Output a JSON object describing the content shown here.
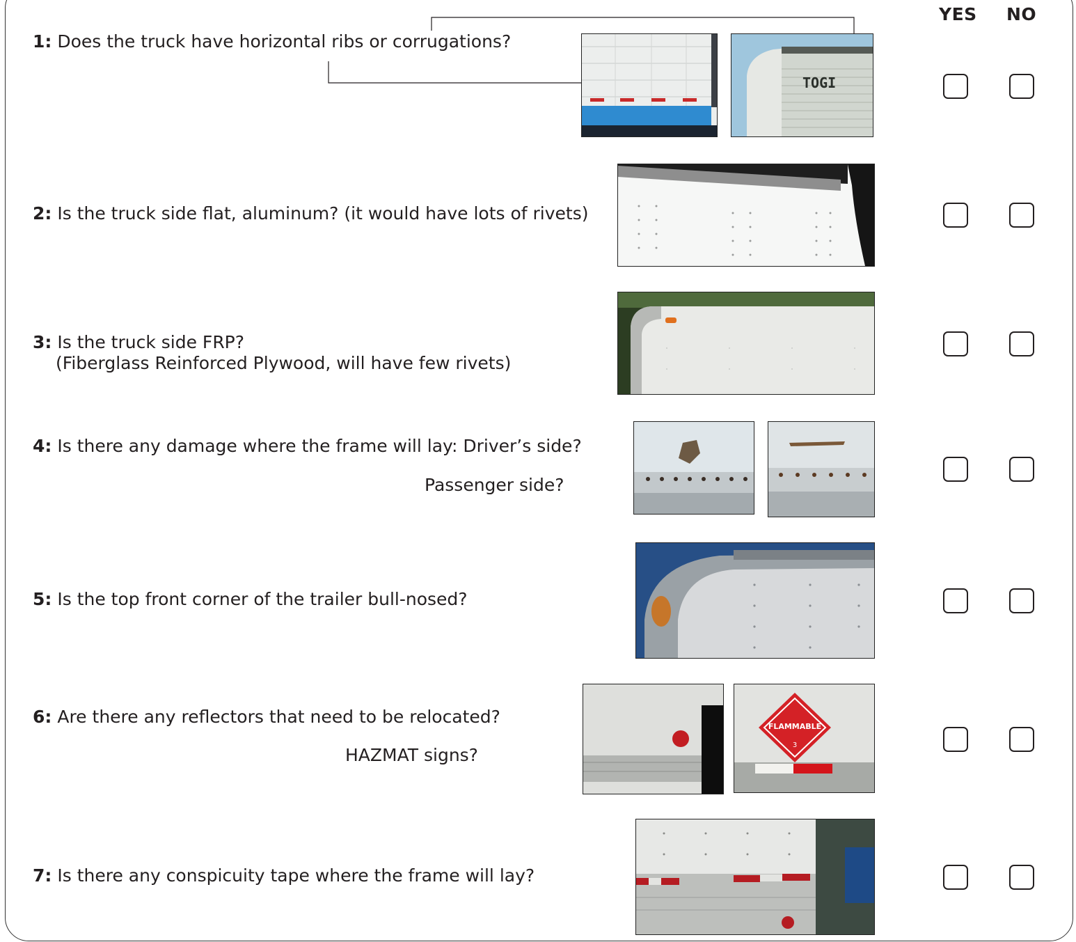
{
  "header": {
    "yes": "YES",
    "no": "NO"
  },
  "questions": [
    {
      "num": "1:",
      "text": " Does the truck have horizontal ribs or corrugations?"
    },
    {
      "num": "2:",
      "text": " Is the truck side flat, aluminum? (it would have lots of rivets)"
    },
    {
      "num": "3:",
      "text": " Is the truck side FRP?",
      "line2": "(Fiberglass Reinforced Plywood, will have few rivets)"
    },
    {
      "num": "4:",
      "text": " Is there any damage where the frame will lay: Driver’s side?",
      "line2": "Passenger side?"
    },
    {
      "num": "5:",
      "text": " Is the top front corner of the trailer bull-nosed?"
    },
    {
      "num": "6:",
      "text": " Are there any reflectors that need to be relocated?",
      "line2": "HAZMAT signs?"
    },
    {
      "num": "7:",
      "text": " Is there any conspicuity tape where the frame will lay?"
    }
  ],
  "photos": {
    "q1b_label": "TOGI",
    "q6b_label": "FLAMMABLE",
    "q6b_class": "3"
  }
}
